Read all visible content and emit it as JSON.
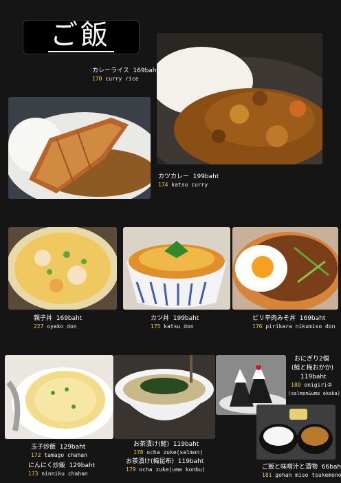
{
  "header": {
    "title": "ご飯"
  },
  "colors": {
    "background": "#151515",
    "number": "#f2d200",
    "text": "#ffffff"
  },
  "items": [
    {
      "name": "カレーライス",
      "price": "169baht",
      "number": "170",
      "romaji": "curry rice"
    },
    {
      "name": "カツカレー",
      "price": "199baht",
      "number": "174",
      "romaji": "katsu curry"
    },
    {
      "name": "親子丼",
      "price": "169baht",
      "number": "227",
      "romaji": "oyako don"
    },
    {
      "name": "カツ丼",
      "price": "199baht",
      "number": "175",
      "romaji": "katsu don"
    },
    {
      "name": "ピリ辛肉みそ丼",
      "price": "169baht",
      "number": "176",
      "romaji": "pirikara nikumiso don"
    },
    {
      "name": "玉子炒飯",
      "price": "129baht",
      "number": "172",
      "romaji": "tamago chahan"
    },
    {
      "name": "にんにく炒飯",
      "price": "129baht",
      "number": "173",
      "romaji": "ninniku chahan"
    },
    {
      "name": "お茶漬け(鮭)",
      "price": "119baht",
      "number": "178",
      "romaji": "ocha zuke(salmon)"
    },
    {
      "name": "お茶漬け(梅昆布)",
      "price": "119baht",
      "number": "179",
      "romaji": "ocha zuke(ume konbu)"
    },
    {
      "name": "おにぎり2個",
      "name2": "(鮭と梅おかか)",
      "price": "119baht",
      "number": "180",
      "romaji": "onigiri②",
      "romaji2": "(salmon&ume okaka)"
    },
    {
      "name": "ご飯と味噌汁と漬物",
      "price": "66baht",
      "number": "181",
      "romaji": "gohan miso tsukemono"
    }
  ]
}
